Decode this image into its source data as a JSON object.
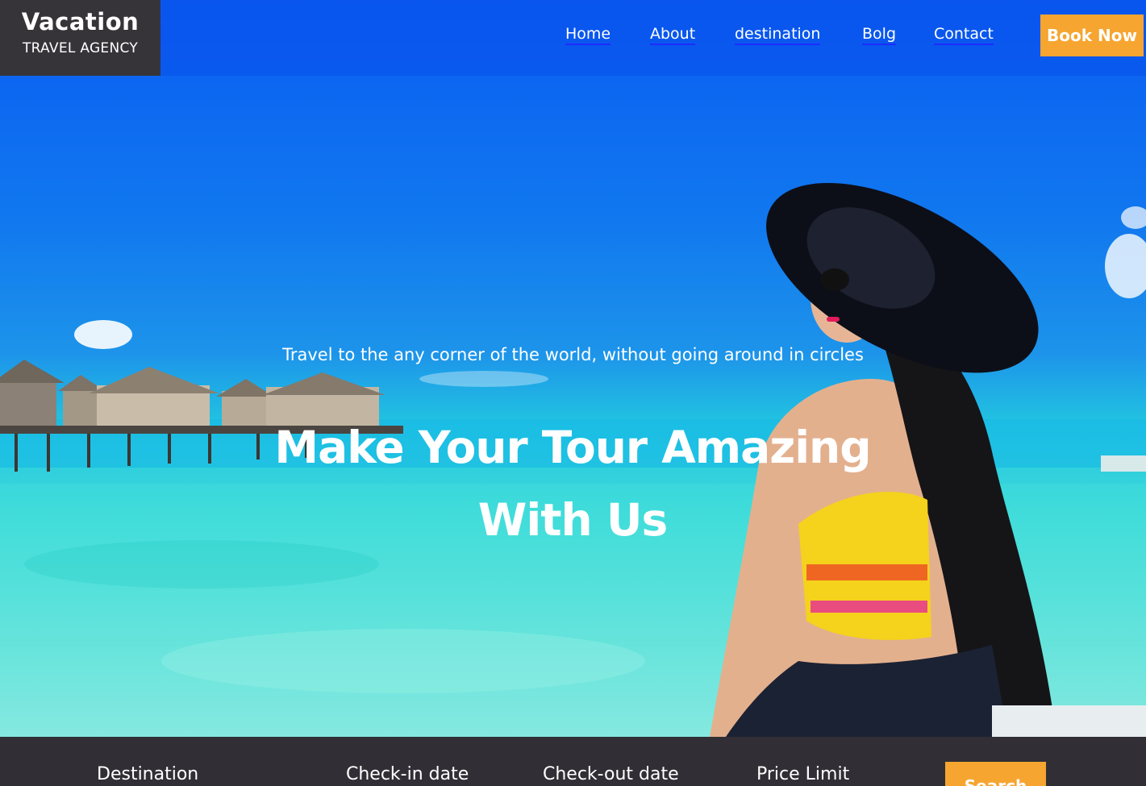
{
  "brand": {
    "title": "Vacation",
    "subtitle": "TRAVEL AGENCY"
  },
  "nav": {
    "items": [
      "Home",
      "About",
      "destination",
      "Bolg",
      "Contact"
    ],
    "book_now": "Book Now"
  },
  "hero": {
    "tagline": "Travel to the any corner of the world, without going around in circles",
    "headline": "Make Your Tour Amazing With Us"
  },
  "search": {
    "labels": [
      "Destination",
      "Check-in date",
      "Check-out date",
      "Price Limit"
    ],
    "button": "Search"
  },
  "colors": {
    "accent": "#f6a530",
    "dark": "#363439",
    "nav_underline": "#1f2bff"
  }
}
